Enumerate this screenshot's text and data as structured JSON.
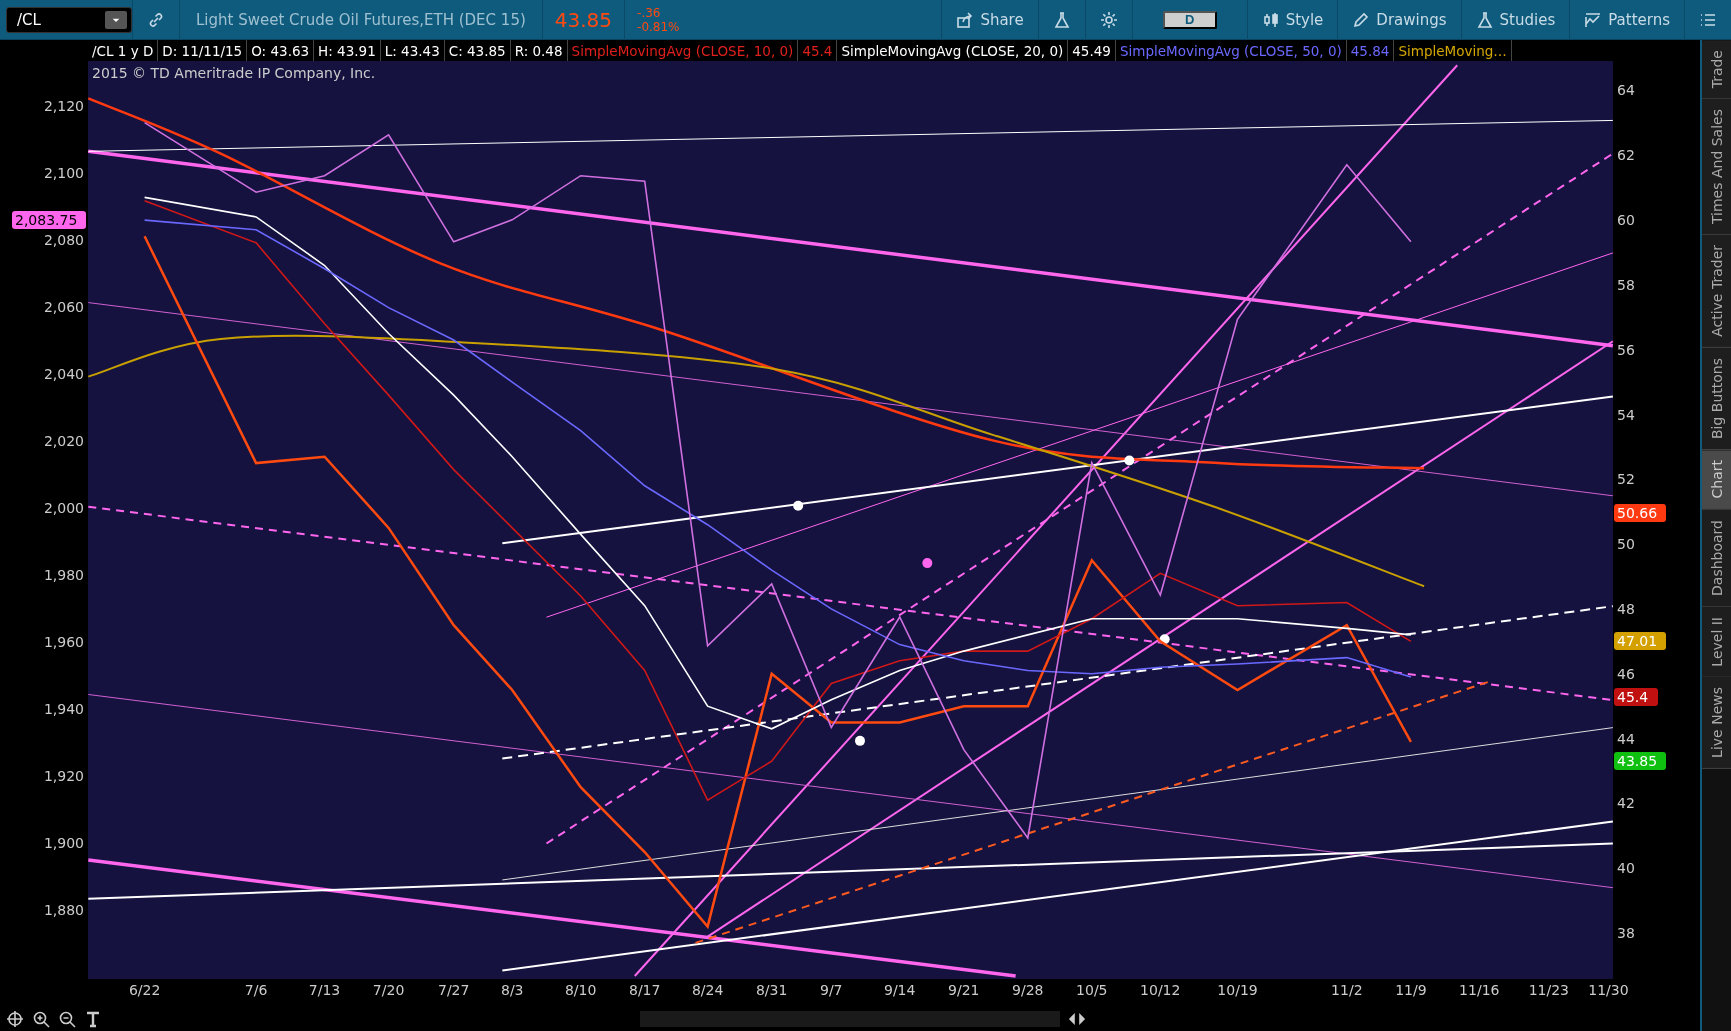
{
  "toolbar": {
    "symbol": "/CL",
    "description": "Light Sweet Crude Oil Futures,ETH (DEC 15)",
    "last": "43.85",
    "change": "-.36",
    "change_pct": "-0.81%",
    "buttons": [
      {
        "kind": "share",
        "label": "Share"
      },
      {
        "kind": "flask"
      },
      {
        "kind": "gear"
      },
      {
        "kind": "period",
        "label": "D"
      },
      {
        "kind": "style",
        "label": "Style"
      },
      {
        "kind": "drawings",
        "label": "Drawings"
      },
      {
        "kind": "studies",
        "label": "Studies"
      },
      {
        "kind": "patterns",
        "label": "Patterns"
      },
      {
        "kind": "menu"
      }
    ]
  },
  "info_bar": {
    "fields": [
      "/CL 1 y D",
      "D: 11/11/15",
      "O: 43.63",
      "H: 43.91",
      "L: 43.43",
      "C: 43.85",
      "R: 0.48"
    ],
    "study_values": [
      "45.4",
      "45.49",
      "45.84"
    ],
    "more_studies": "SimpleMoving…"
  },
  "copyright": "2015 © TD Ameritrade IP Company, Inc.",
  "left_axis": [
    "2,120",
    "2,100",
    "2,080",
    "2,060",
    "2,040",
    "2,020",
    "2,000",
    "1,980",
    "1,960",
    "1,940",
    "1,920",
    "1,900",
    "1,880"
  ],
  "price_badges": [
    {
      "text": "2,083.75",
      "color": "#ff66ee"
    },
    {
      "text": "50.66",
      "color": "#ff3a10"
    },
    {
      "text": "47.01",
      "color": "#d4a000"
    },
    {
      "text": "45.4",
      "color": "#c01010"
    },
    {
      "text": "43.85",
      "color": "#10c010"
    }
  ],
  "chart_data": {
    "type": "line",
    "x": [
      "6/22",
      "7/6",
      "7/13",
      "7/20",
      "7/27",
      "8/3",
      "8/10",
      "8/17",
      "8/24",
      "8/31",
      "9/7",
      "9/14",
      "9/21",
      "9/28",
      "10/5",
      "10/12",
      "10/19",
      "11/2",
      "11/9",
      "11/16",
      "11/23",
      "11/30"
    ],
    "ylim": [
      36.58,
      64.91
    ],
    "yticks": [
      38,
      40,
      42,
      44,
      46,
      48,
      50,
      52,
      54,
      56,
      58,
      60,
      62,
      64
    ],
    "series": [
      {
        "color": "#ff4a10",
        "values": [
          59.5,
          52.5,
          52.7,
          50.5,
          47.5,
          45.5,
          42.5,
          40.5,
          38.2,
          46,
          44.5,
          44.5,
          45,
          45,
          49.5,
          47,
          45.5,
          47.5,
          43.9,
          null,
          null,
          null
        ]
      },
      {
        "name": "SimpleMovingAvg (CLOSE, 10, 0)",
        "color": "#d01818",
        "values": [
          60.6,
          59.3,
          56.8,
          54.6,
          52.3,
          50.5,
          48.4,
          46.1,
          42.1,
          43.3,
          45.7,
          46.4,
          46.7,
          46.7,
          47.7,
          49.1,
          48.1,
          48.2,
          47.0,
          null,
          null,
          null
        ]
      },
      {
        "name": "SimpleMovingAvg (CLOSE, 20, 0)",
        "color": "#ffffff",
        "values": [
          60.7,
          60.1,
          58.6,
          56.5,
          54.6,
          52.7,
          50.3,
          48.1,
          45.0,
          44.3,
          45.2,
          46.1,
          46.7,
          47.2,
          47.7,
          47.7,
          47.7,
          47.4,
          47.2,
          null,
          null,
          null
        ]
      },
      {
        "name": "SimpleMovingAvg (CLOSE, 50, 0)",
        "color": "#6a68ff",
        "values": [
          60.0,
          59.7,
          58.5,
          57.3,
          56.3,
          55.0,
          53.5,
          51.8,
          50.6,
          49.2,
          48.0,
          46.9,
          46.4,
          46.1,
          46.0,
          46.2,
          46.3,
          46.5,
          45.9,
          null,
          null,
          null
        ]
      },
      {
        "color": "#d070e0",
        "values": [
          63.01,
          60.86,
          61.37,
          62.63,
          59.33,
          60.01,
          61.37,
          61.2,
          46.86,
          48.77,
          44.34,
          47.75,
          43.66,
          40.93,
          52.51,
          48.43,
          56.94,
          61.71,
          59.33,
          null,
          null,
          null
        ]
      }
    ]
  },
  "side_tabs": [
    {
      "label": "Trade",
      "selected": false
    },
    {
      "label": "Times And Sales",
      "selected": false
    },
    {
      "label": "Active Trader",
      "selected": false
    },
    {
      "label": "Big Buttons",
      "selected": false
    },
    {
      "label": "Chart",
      "selected": true
    },
    {
      "label": "Dashboard",
      "selected": false
    },
    {
      "label": "Level II",
      "selected": false
    },
    {
      "label": "Live News",
      "selected": false
    }
  ]
}
